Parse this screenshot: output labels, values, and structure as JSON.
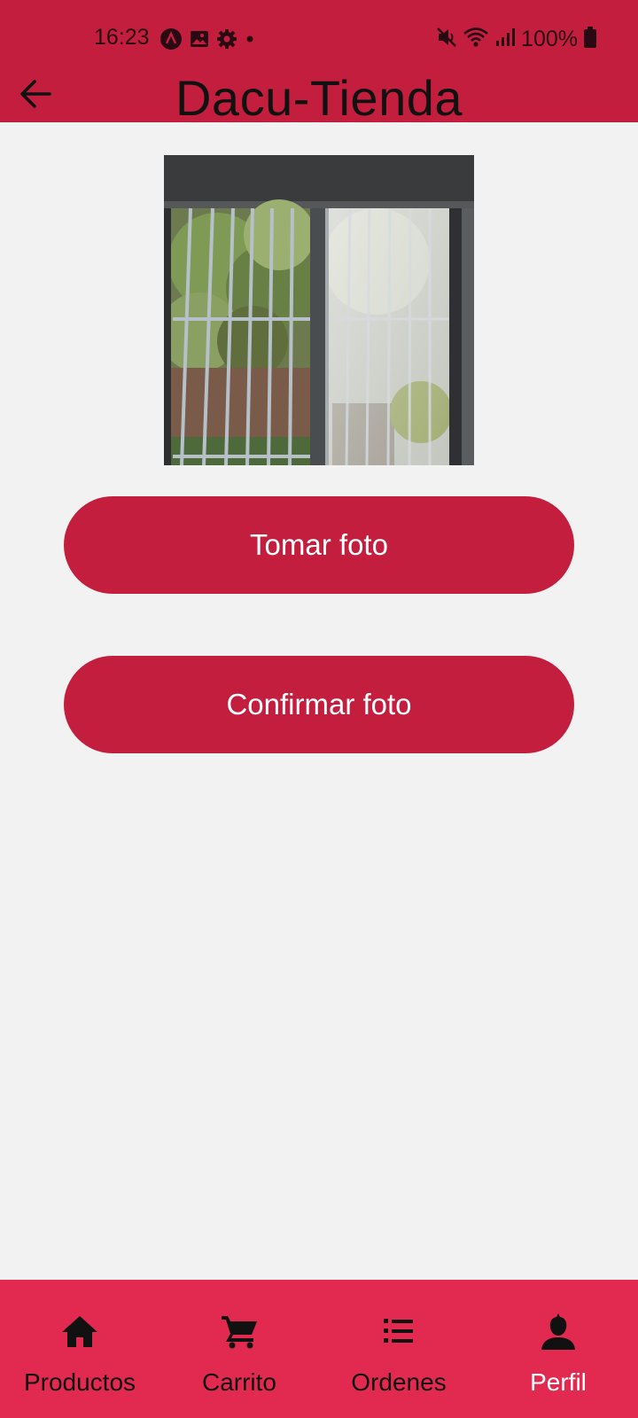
{
  "status_bar": {
    "time": "16:23",
    "battery_text": "100%",
    "left_icons": [
      "app-notification-icon",
      "gallery-icon",
      "settings-icon",
      "dot-icon"
    ],
    "right_icons": [
      "mute-icon",
      "wifi-icon",
      "signal-icon",
      "battery-icon"
    ]
  },
  "app_bar": {
    "title": "Dacu-Tienda",
    "back_icon": "arrow-left-icon"
  },
  "photo": {
    "description_icon": "photo-preview"
  },
  "buttons": {
    "take_photo": "Tomar foto",
    "confirm_photo": "Confirmar foto"
  },
  "bottom_nav": {
    "items": [
      {
        "label": "Productos",
        "icon": "home-icon",
        "active": false
      },
      {
        "label": "Carrito",
        "icon": "cart-icon",
        "active": false
      },
      {
        "label": "Ordenes",
        "icon": "list-icon",
        "active": false
      },
      {
        "label": "Perfil",
        "icon": "person-icon",
        "active": true
      }
    ]
  },
  "colors": {
    "primary": "#c41e3e",
    "nav_background": "#e22a50",
    "page_background": "#f2f2f2"
  }
}
